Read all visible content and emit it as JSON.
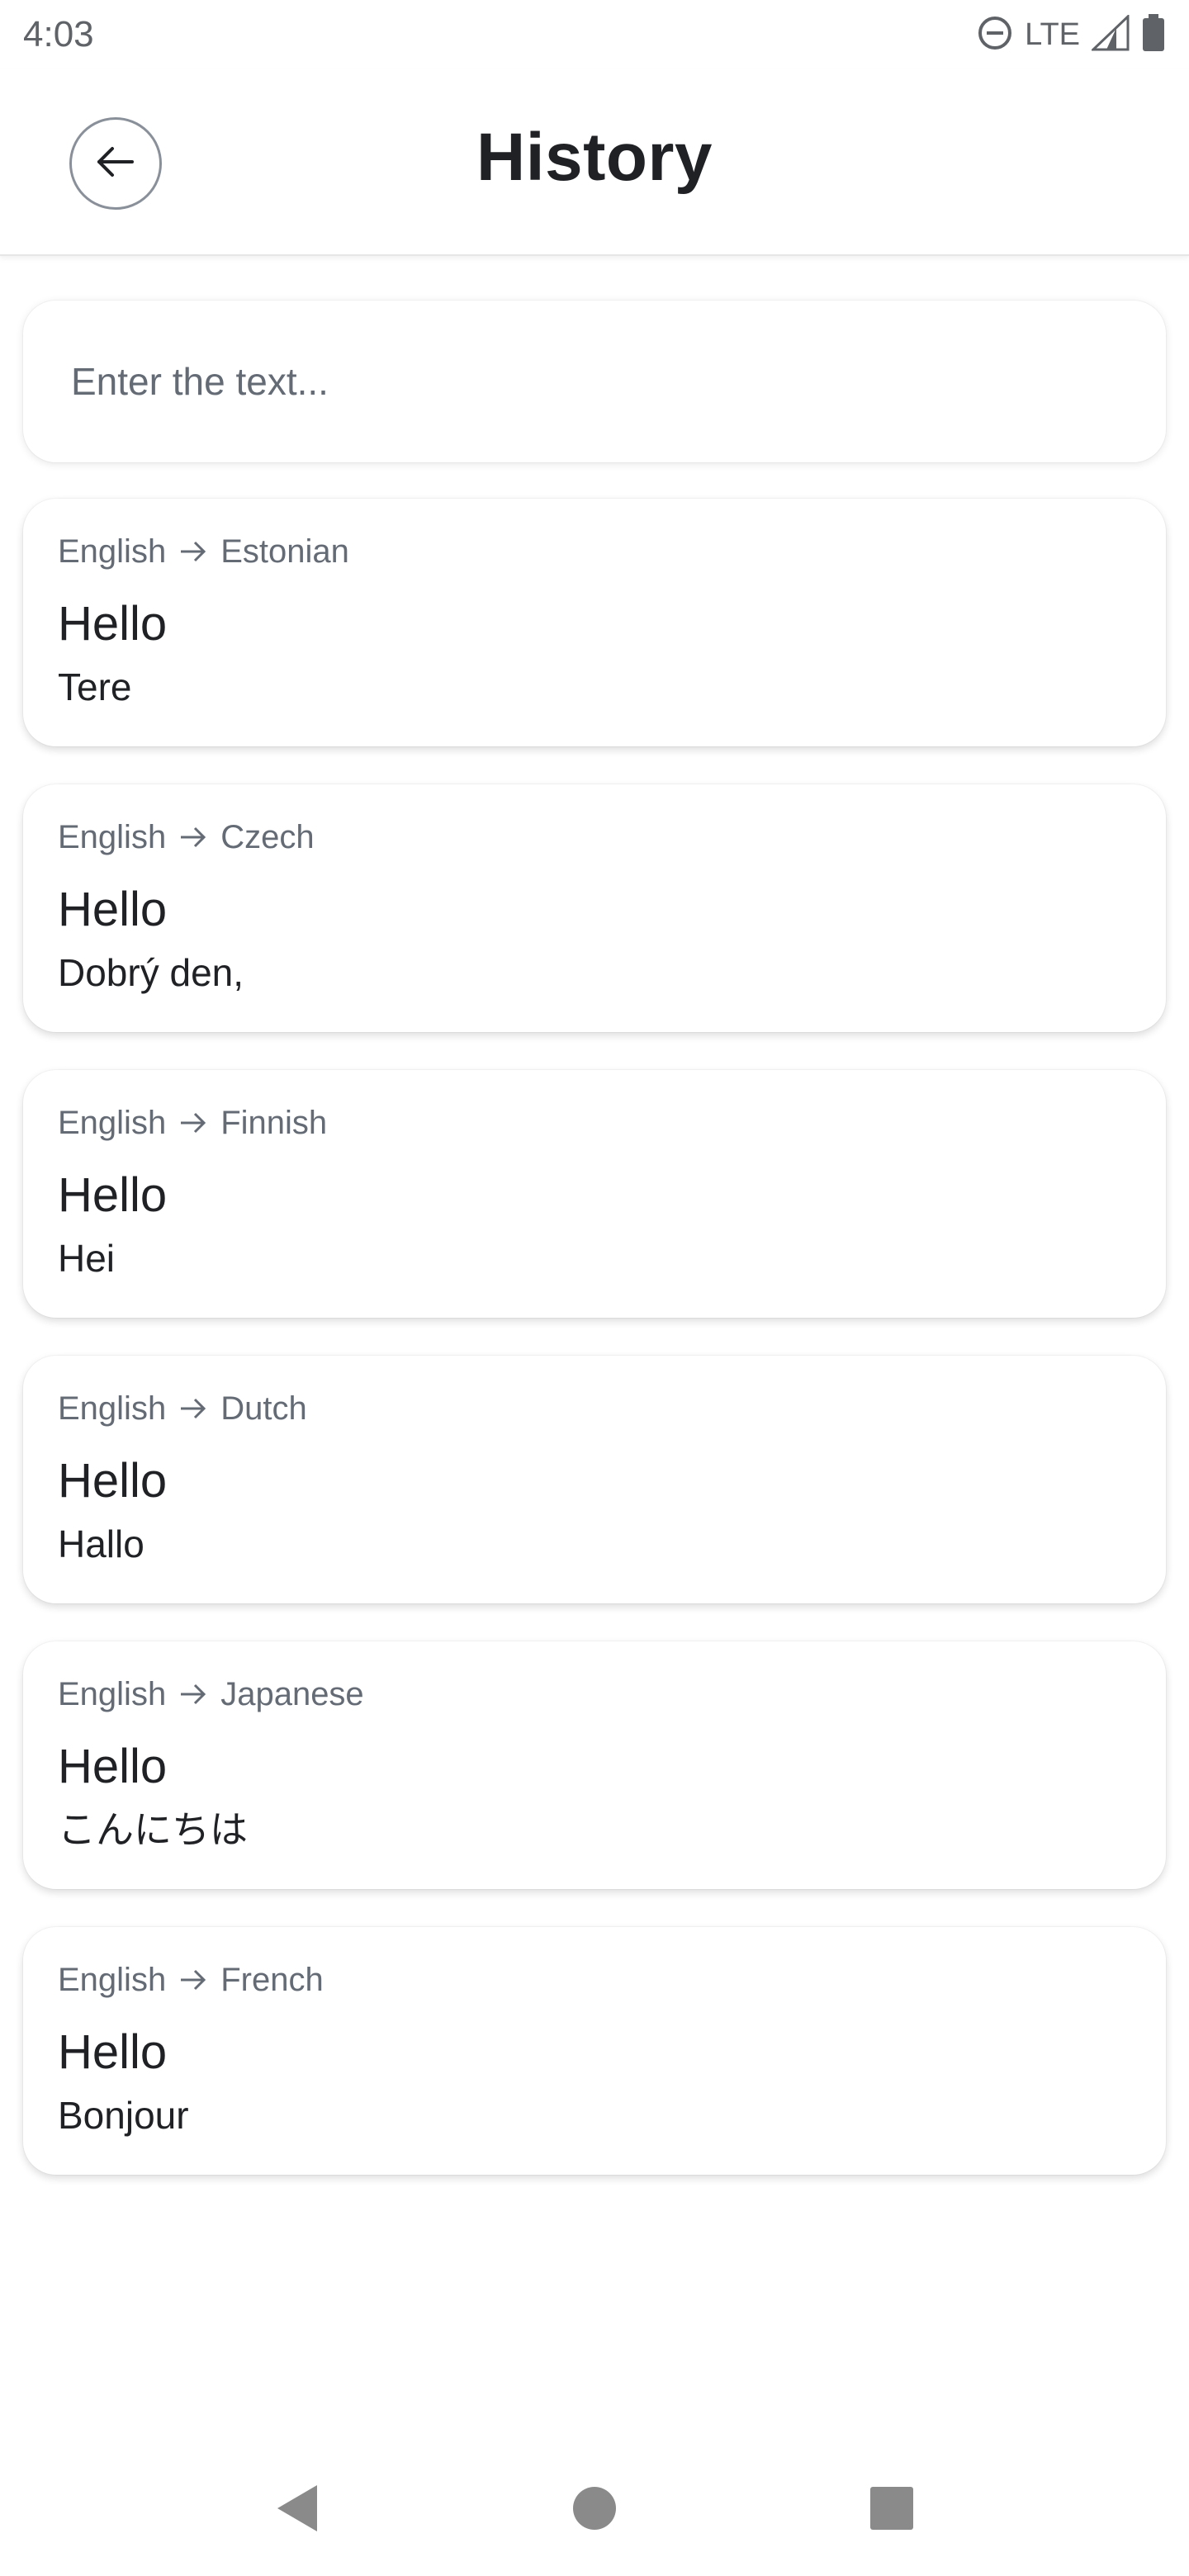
{
  "status_bar": {
    "time": "4:03",
    "network": "LTE",
    "icons": [
      "do-not-disturb-icon",
      "signal-icon",
      "battery-icon"
    ]
  },
  "header": {
    "title": "History",
    "back_icon": "arrow-left-icon"
  },
  "search": {
    "placeholder": "Enter the text...",
    "value": ""
  },
  "history": [
    {
      "source_lang": "English",
      "target_lang": "Estonian",
      "source_text": "Hello",
      "translated_text": "Tere"
    },
    {
      "source_lang": "English",
      "target_lang": "Czech",
      "source_text": "Hello",
      "translated_text": "Dobrý den,"
    },
    {
      "source_lang": "English",
      "target_lang": "Finnish",
      "source_text": "Hello",
      "translated_text": "Hei"
    },
    {
      "source_lang": "English",
      "target_lang": "Dutch",
      "source_text": "Hello",
      "translated_text": "Hallo"
    },
    {
      "source_lang": "English",
      "target_lang": "Japanese",
      "source_text": "Hello",
      "translated_text": "こんにちは"
    },
    {
      "source_lang": "English",
      "target_lang": "French",
      "source_text": "Hello",
      "translated_text": "Bonjour"
    }
  ],
  "nav_bar": {
    "icons": [
      "back-triangle-icon",
      "home-circle-icon",
      "recents-square-icon"
    ]
  },
  "colors": {
    "text_primary": "#1f2125",
    "text_secondary": "#646b75",
    "icon_gray": "#8a9099",
    "background": "#ffffff"
  }
}
